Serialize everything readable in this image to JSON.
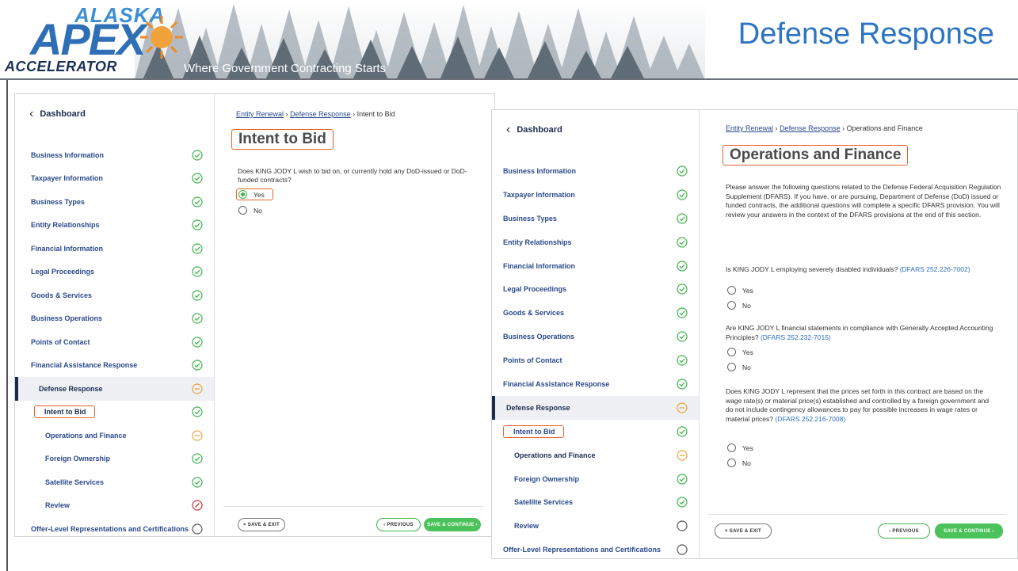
{
  "banner": {
    "logo_top": "ALASKA",
    "logo_main": "APEX",
    "logo_bottom": "ACCELERATOR",
    "tagline": "Where Government Contracting Starts",
    "title": "Defense Response"
  },
  "colors": {
    "accent_blue": "#2d74c4",
    "nav_text": "#2a4a8c",
    "complete_green": "#3bb44a",
    "in_progress_orange": "#e8a33c",
    "error_red": "#c8323a",
    "highlight_box": "#e4652d"
  },
  "panel1": {
    "dashboard_label": "Dashboard",
    "nav": [
      {
        "label": "Business Information",
        "status": "complete"
      },
      {
        "label": "Taxpayer Information",
        "status": "complete"
      },
      {
        "label": "Business Types",
        "status": "complete"
      },
      {
        "label": "Entity Relationships",
        "status": "complete"
      },
      {
        "label": "Financial Information",
        "status": "complete"
      },
      {
        "label": "Legal Proceedings",
        "status": "complete"
      },
      {
        "label": "Goods & Services",
        "status": "complete"
      },
      {
        "label": "Business Operations",
        "status": "complete"
      },
      {
        "label": "Points of Contact",
        "status": "complete"
      },
      {
        "label": "Financial Assistance Response",
        "status": "complete"
      },
      {
        "label": "Defense Response",
        "status": "in-progress"
      },
      {
        "label": "Intent to Bid",
        "status": "complete"
      },
      {
        "label": "Operations and Finance",
        "status": "in-progress"
      },
      {
        "label": "Foreign Ownership",
        "status": "complete"
      },
      {
        "label": "Satellite Services",
        "status": "complete"
      },
      {
        "label": "Review",
        "status": "error"
      },
      {
        "label": "Offer-Level Representations and Certifications",
        "status": "empty"
      }
    ],
    "breadcrumb": {
      "link1": "Entity Renewal",
      "link2": "Defense Response",
      "current": "Intent to Bid",
      "sep": "›"
    },
    "heading": "Intent to Bid",
    "question": "Does KING JODY L wish to bid on, or currently hold any DoD-issued or DoD-funded contracts?",
    "options": [
      "Yes",
      "No"
    ],
    "selected": "Yes",
    "save_exit": "× SAVE & EXIT",
    "previous": "‹ PREVIOUS",
    "save_continue": "SAVE & CONTINUE ›"
  },
  "panel2": {
    "dashboard_label": "Dashboard",
    "nav": [
      {
        "label": "Business Information",
        "status": "complete"
      },
      {
        "label": "Taxpayer Information",
        "status": "complete"
      },
      {
        "label": "Business Types",
        "status": "complete"
      },
      {
        "label": "Entity Relationships",
        "status": "complete"
      },
      {
        "label": "Financial Information",
        "status": "complete"
      },
      {
        "label": "Legal Proceedings",
        "status": "complete"
      },
      {
        "label": "Goods & Services",
        "status": "complete"
      },
      {
        "label": "Business Operations",
        "status": "complete"
      },
      {
        "label": "Points of Contact",
        "status": "complete"
      },
      {
        "label": "Financial Assistance Response",
        "status": "complete"
      },
      {
        "label": "Defense Response",
        "status": "in-progress"
      },
      {
        "label": "Intent to Bid",
        "status": "complete"
      },
      {
        "label": "Operations and Finance",
        "status": "in-progress"
      },
      {
        "label": "Foreign Ownership",
        "status": "complete"
      },
      {
        "label": "Satellite Services",
        "status": "complete"
      },
      {
        "label": "Review",
        "status": "empty"
      },
      {
        "label": "Offer-Level Representations and Certifications",
        "status": "empty"
      }
    ],
    "breadcrumb": {
      "link1": "Entity Renewal",
      "link2": "Defense Response",
      "current": "Operations and Finance",
      "sep": "›"
    },
    "heading": "Operations and Finance",
    "intro": "Please answer the following questions related to the Defense Federal Acquisition Regulation Supplement (DFARS). If you have, or are pursuing, Department of Defense (DoD) issued or funded contracts, the additional questions will complete a specific DFARS provision. You will review your answers in the context of the DFARS provisions at the end of this section.",
    "questions": [
      {
        "text": "Is KING JODY L employing severely disabled individuals? ",
        "ref": "(DFARS 252.226-7002)"
      },
      {
        "text": "Are KING JODY L financial statements in compliance with Generally Accepted Accounting Principles? ",
        "ref": "(DFARS 252.232-7015)"
      },
      {
        "text": "Does KING JODY L represent that the prices set forth in this contract are based on the wage rate(s) or material price(s) established and controlled by a foreign government and do not include contingency allowances to pay for possible increases in wage rates or material prices? ",
        "ref": "(DFARS 252.216-7008)"
      }
    ],
    "options": [
      "Yes",
      "No"
    ],
    "save_exit": "× SAVE & EXIT",
    "previous": "‹ PREVIOUS",
    "save_continue": "SAVE & CONTINUE ›"
  }
}
